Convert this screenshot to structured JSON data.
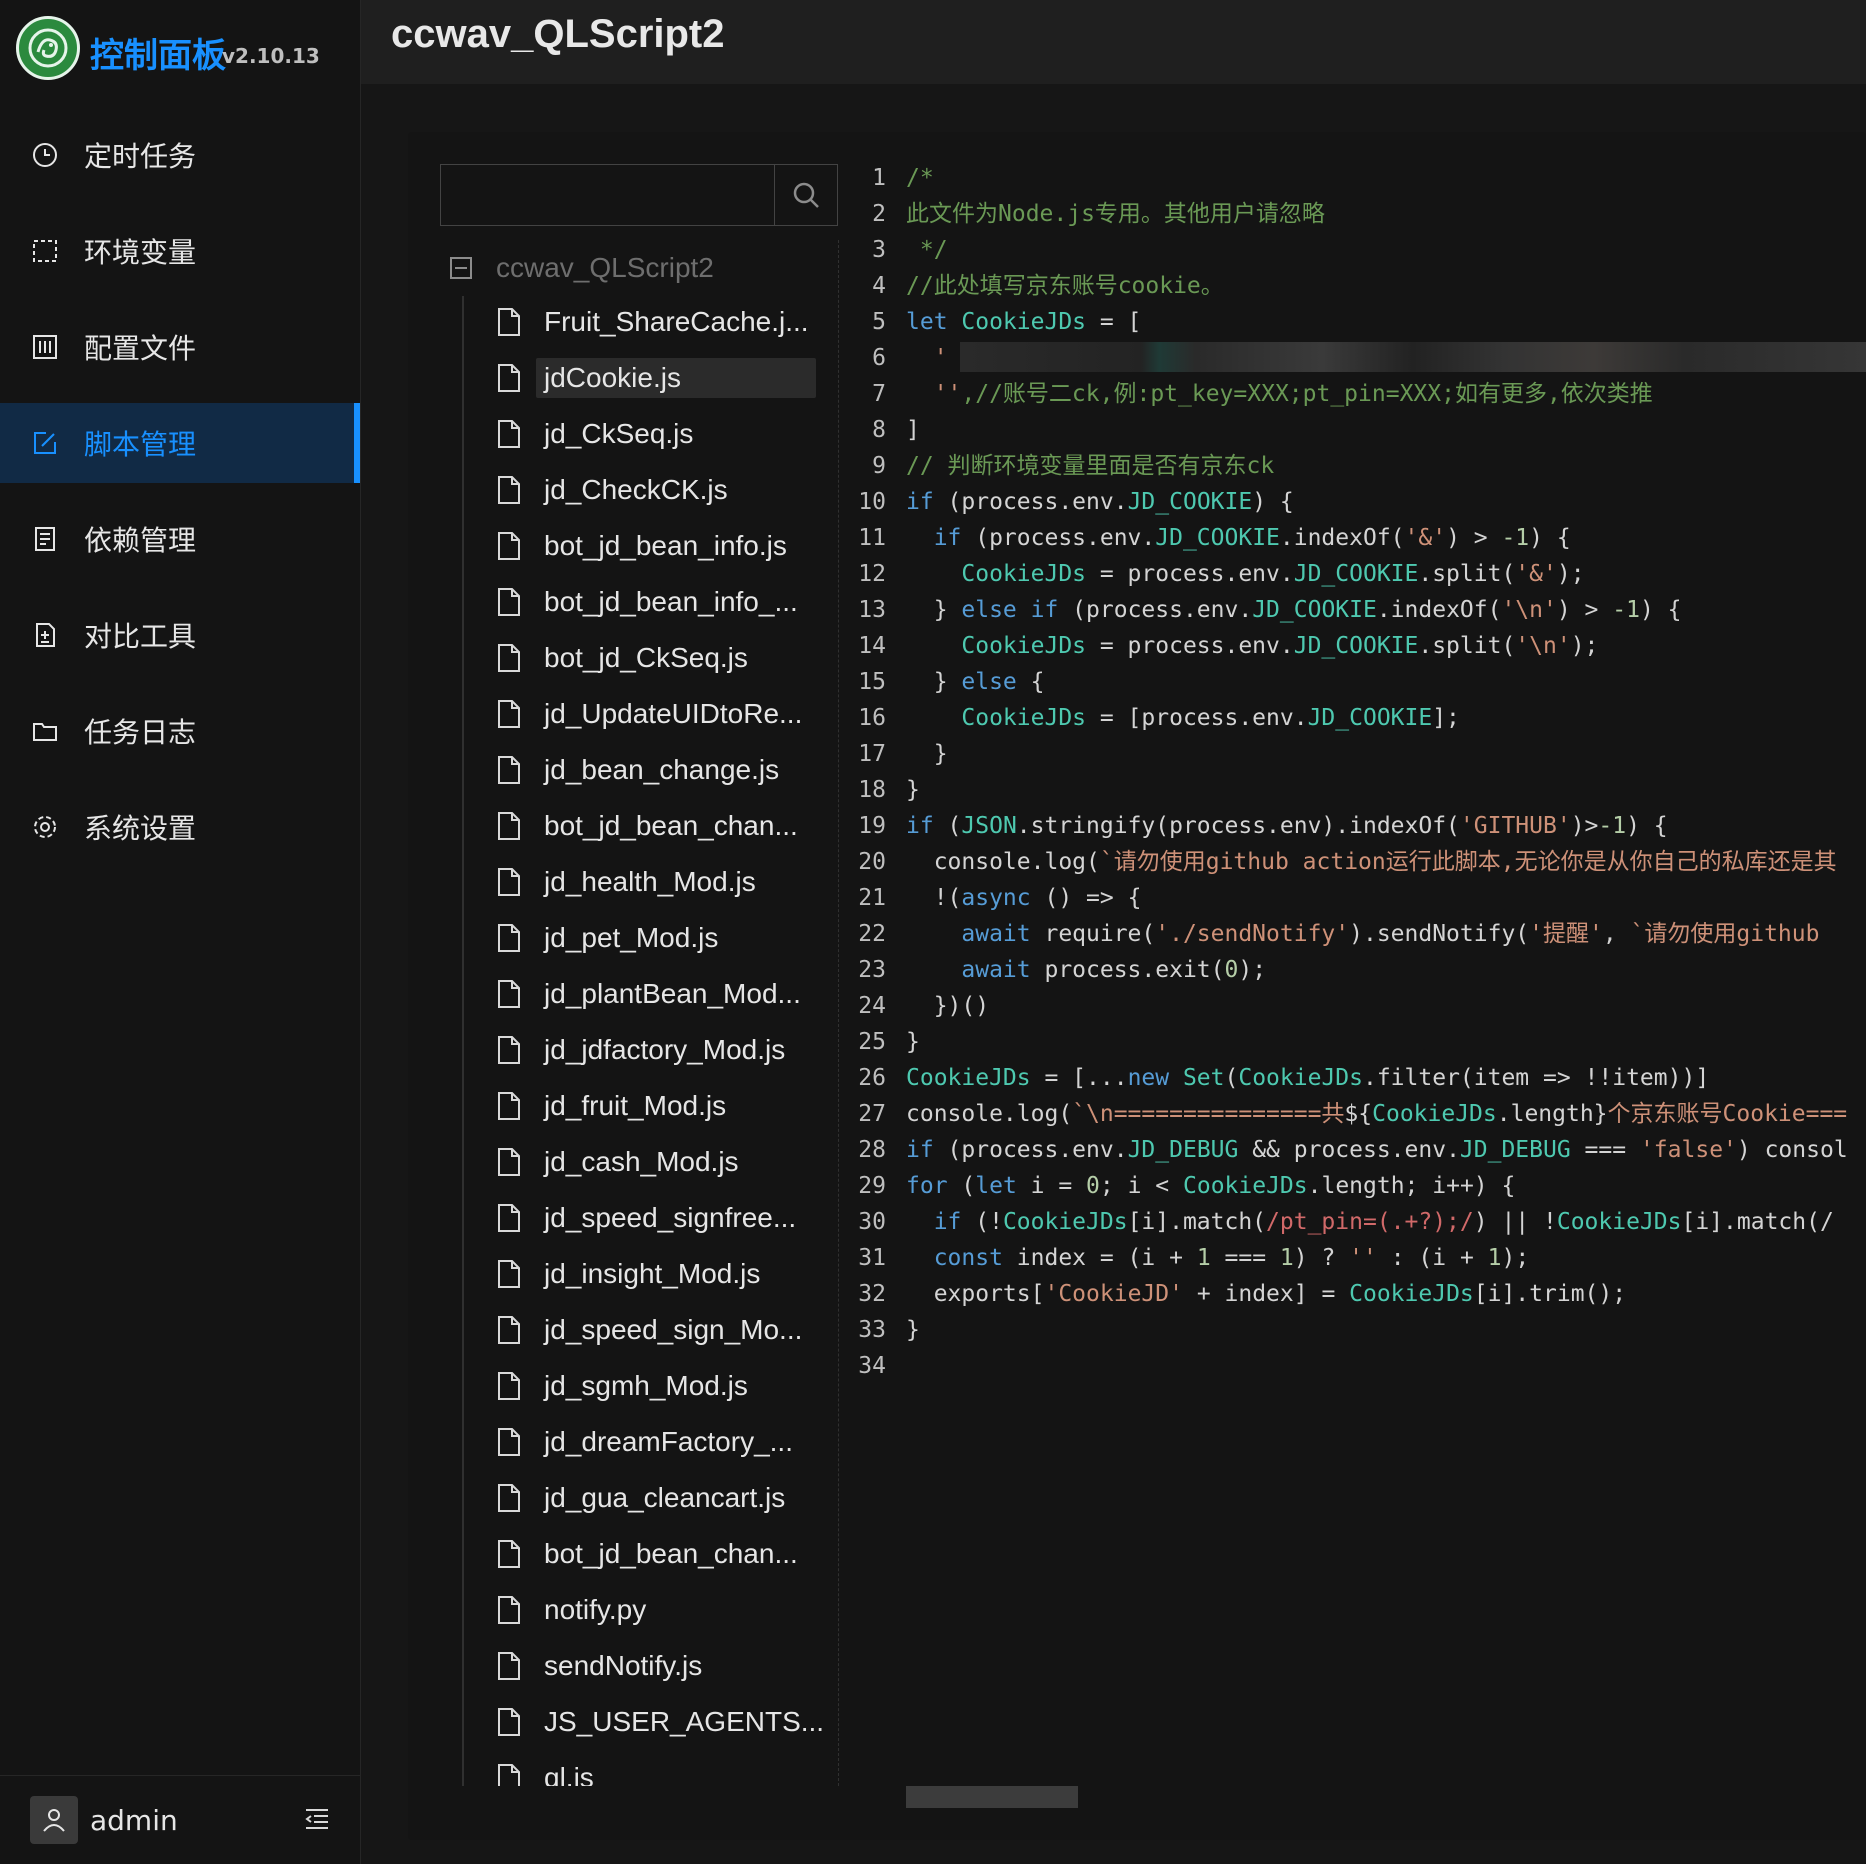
{
  "app": {
    "brand": "控制面板",
    "version": "v2.10.13"
  },
  "sidebar": {
    "items": [
      {
        "label": "定时任务",
        "icon": "clock-icon"
      },
      {
        "label": "环境变量",
        "icon": "env-icon"
      },
      {
        "label": "配置文件",
        "icon": "config-icon"
      },
      {
        "label": "脚本管理",
        "icon": "edit-icon",
        "active": true
      },
      {
        "label": "依赖管理",
        "icon": "dependency-icon"
      },
      {
        "label": "对比工具",
        "icon": "diff-icon"
      },
      {
        "label": "任务日志",
        "icon": "folder-icon"
      },
      {
        "label": "系统设置",
        "icon": "gear-icon"
      }
    ],
    "user": "admin"
  },
  "header": {
    "title": "ccwav_QLScript2"
  },
  "tree": {
    "search_placeholder": "",
    "root": "ccwav_QLScript2",
    "selected": "jdCookie.js",
    "files": [
      "Fruit_ShareCache.j...",
      "jdCookie.js",
      "jd_CkSeq.js",
      "jd_CheckCK.js",
      "bot_jd_bean_info.js",
      "bot_jd_bean_info_...",
      "bot_jd_CkSeq.js",
      "jd_UpdateUIDtoRe...",
      "jd_bean_change.js",
      "bot_jd_bean_chan...",
      "jd_health_Mod.js",
      "jd_pet_Mod.js",
      "jd_plantBean_Mod...",
      "jd_jdfactory_Mod.js",
      "jd_fruit_Mod.js",
      "jd_cash_Mod.js",
      "jd_speed_signfree...",
      "jd_insight_Mod.js",
      "jd_speed_sign_Mo...",
      "jd_sgmh_Mod.js",
      "jd_dreamFactory_...",
      "jd_gua_cleancart.js",
      "bot_jd_bean_chan...",
      "notify.py",
      "sendNotify.js",
      "JS_USER_AGENTS...",
      "ql.js"
    ]
  },
  "colors": {
    "accent": "#1890ff",
    "comment": "#6a9955",
    "keyword": "#569cd6",
    "variable": "#4ec9b0",
    "string": "#ce9178",
    "number": "#b5cea8",
    "regex": "#d16969",
    "plain": "#d4d4d4"
  },
  "editor": {
    "lines": [
      [
        [
          "c",
          "/*"
        ]
      ],
      [
        [
          "c",
          "此文件为Node.js专用。其他用户请忽略"
        ]
      ],
      [
        [
          "c",
          " */"
        ]
      ],
      [
        [
          "c",
          "//此处填写京东账号cookie。"
        ]
      ],
      [
        [
          "k",
          "let "
        ],
        [
          "v",
          "CookieJDs"
        ],
        [
          "p",
          " = ["
        ]
      ],
      [
        [
          "s",
          "  '"
        ]
      ],
      [
        [
          "s",
          "  ''"
        ],
        [
          "c",
          ",//账号二ck,例:pt_key=XXX;pt_pin=XXX;如有更多,依次类推"
        ]
      ],
      [
        [
          "p",
          "]"
        ]
      ],
      [
        [
          "c",
          "// 判断环境变量里面是否有京东ck"
        ]
      ],
      [
        [
          "k",
          "if"
        ],
        [
          "p",
          " (process.env."
        ],
        [
          "v",
          "JD_COOKIE"
        ],
        [
          "p",
          ") {"
        ]
      ],
      [
        [
          "k",
          "  if"
        ],
        [
          "p",
          " (process.env."
        ],
        [
          "v",
          "JD_COOKIE"
        ],
        [
          "p",
          ".indexOf("
        ],
        [
          "s",
          "'&'"
        ],
        [
          "p",
          ") > "
        ],
        [
          "n",
          "-1"
        ],
        [
          "p",
          ") {"
        ]
      ],
      [
        [
          "v",
          "    CookieJDs"
        ],
        [
          "p",
          " = process.env."
        ],
        [
          "v",
          "JD_COOKIE"
        ],
        [
          "p",
          ".split("
        ],
        [
          "s",
          "'&'"
        ],
        [
          "p",
          ");"
        ]
      ],
      [
        [
          "p",
          "  } "
        ],
        [
          "k",
          "else if"
        ],
        [
          "p",
          " (process.env."
        ],
        [
          "v",
          "JD_COOKIE"
        ],
        [
          "p",
          ".indexOf("
        ],
        [
          "s",
          "'\\n'"
        ],
        [
          "p",
          ") > "
        ],
        [
          "n",
          "-1"
        ],
        [
          "p",
          ") {"
        ]
      ],
      [
        [
          "v",
          "    CookieJDs"
        ],
        [
          "p",
          " = process.env."
        ],
        [
          "v",
          "JD_COOKIE"
        ],
        [
          "p",
          ".split("
        ],
        [
          "s",
          "'\\n'"
        ],
        [
          "p",
          ");"
        ]
      ],
      [
        [
          "p",
          "  } "
        ],
        [
          "k",
          "else"
        ],
        [
          "p",
          " {"
        ]
      ],
      [
        [
          "v",
          "    CookieJDs"
        ],
        [
          "p",
          " = [process.env."
        ],
        [
          "v",
          "JD_COOKIE"
        ],
        [
          "p",
          "];"
        ]
      ],
      [
        [
          "p",
          "  }"
        ]
      ],
      [
        [
          "p",
          "}"
        ]
      ],
      [
        [
          "k",
          "if"
        ],
        [
          "p",
          " ("
        ],
        [
          "v",
          "JSON"
        ],
        [
          "p",
          ".stringify(process.env).indexOf("
        ],
        [
          "s",
          "'GITHUB'"
        ],
        [
          "p",
          ")>"
        ],
        [
          "n",
          "-1"
        ],
        [
          "p",
          ") {"
        ]
      ],
      [
        [
          "p",
          "  console.log("
        ],
        [
          "s",
          "`请勿使用github action运行此脚本,无论你是从你自己的私库还是其"
        ]
      ],
      [
        [
          "p",
          "  !("
        ],
        [
          "k",
          "async"
        ],
        [
          "p",
          " () => {"
        ]
      ],
      [
        [
          "k",
          "    await"
        ],
        [
          "p",
          " require("
        ],
        [
          "s",
          "'./sendNotify'"
        ],
        [
          "p",
          ").sendNotify("
        ],
        [
          "s",
          "'提醒'"
        ],
        [
          "p",
          ", "
        ],
        [
          "s",
          "`请勿使用github"
        ]
      ],
      [
        [
          "k",
          "    await"
        ],
        [
          "p",
          " process.exit("
        ],
        [
          "n",
          "0"
        ],
        [
          "p",
          ");"
        ]
      ],
      [
        [
          "p",
          "  })()"
        ]
      ],
      [
        [
          "p",
          "}"
        ]
      ],
      [
        [
          "v",
          "CookieJDs"
        ],
        [
          "p",
          " = [..."
        ],
        [
          "k",
          "new "
        ],
        [
          "v",
          "Set"
        ],
        [
          "p",
          "("
        ],
        [
          "v",
          "CookieJDs"
        ],
        [
          "p",
          ".filter(item => !!item))]"
        ]
      ],
      [
        [
          "p",
          "console.log("
        ],
        [
          "s",
          "`\\n===============共"
        ],
        [
          "p",
          "${"
        ],
        [
          "v",
          "CookieJDs"
        ],
        [
          "p",
          ".length}"
        ],
        [
          "s",
          "个京东账号Cookie==="
        ]
      ],
      [
        [
          "k",
          "if"
        ],
        [
          "p",
          " (process.env."
        ],
        [
          "v",
          "JD_DEBUG"
        ],
        [
          "p",
          " && process.env."
        ],
        [
          "v",
          "JD_DEBUG"
        ],
        [
          "p",
          " === "
        ],
        [
          "s",
          "'false'"
        ],
        [
          "p",
          ") consol"
        ]
      ],
      [
        [
          "k",
          "for"
        ],
        [
          "p",
          " ("
        ],
        [
          "k",
          "let"
        ],
        [
          "p",
          " i = "
        ],
        [
          "n",
          "0"
        ],
        [
          "p",
          "; i < "
        ],
        [
          "v",
          "CookieJDs"
        ],
        [
          "p",
          ".length; i++) {"
        ]
      ],
      [
        [
          "k",
          "  if"
        ],
        [
          "p",
          " (!"
        ],
        [
          "v",
          "CookieJDs"
        ],
        [
          "p",
          "[i].match("
        ],
        [
          "r",
          "/pt_pin=(.+?);/"
        ],
        [
          "p",
          ") || !"
        ],
        [
          "v",
          "CookieJDs"
        ],
        [
          "p",
          "[i].match(/"
        ]
      ],
      [
        [
          "k",
          "  const"
        ],
        [
          "p",
          " index = (i + "
        ],
        [
          "n",
          "1"
        ],
        [
          "p",
          " === "
        ],
        [
          "n",
          "1"
        ],
        [
          "p",
          ") ? "
        ],
        [
          "s",
          "''"
        ],
        [
          "p",
          " : (i + "
        ],
        [
          "n",
          "1"
        ],
        [
          "p",
          ");"
        ]
      ],
      [
        [
          "p",
          "  exports["
        ],
        [
          "s",
          "'CookieJD'"
        ],
        [
          "p",
          " + index] = "
        ],
        [
          "v",
          "CookieJDs"
        ],
        [
          "p",
          "[i].trim();"
        ]
      ],
      [
        [
          "p",
          "}"
        ]
      ],
      []
    ]
  }
}
